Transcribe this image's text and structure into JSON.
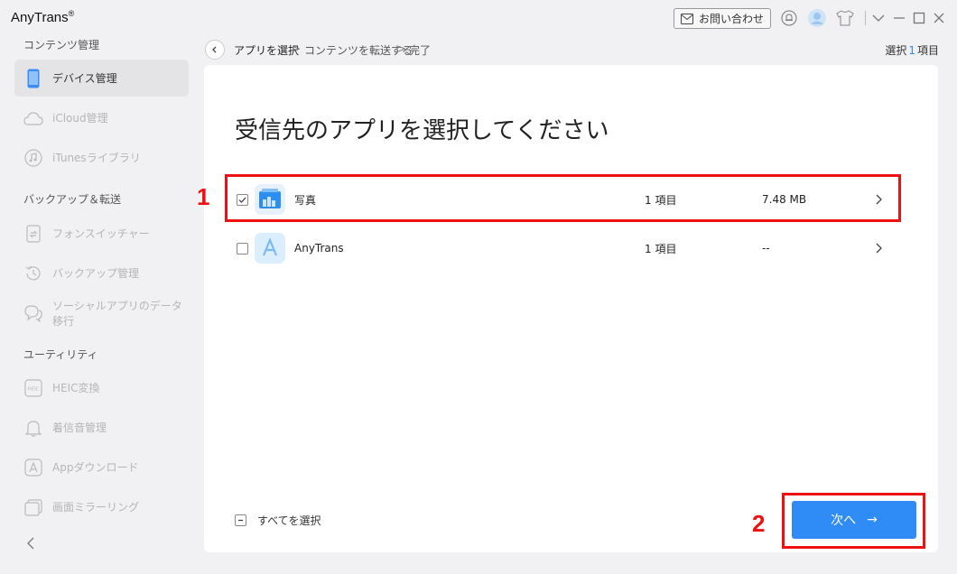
{
  "app": {
    "title": "AnyTrans",
    "registered": "®"
  },
  "titlebar": {
    "contact_label": "お問い合わせ"
  },
  "sidebar": {
    "sections": [
      {
        "title": "コンテンツ管理"
      },
      {
        "title": "バックアップ＆転送"
      },
      {
        "title": "ユーティリティ"
      }
    ],
    "items": [
      {
        "label": "デバイス管理",
        "icon": "phone-icon",
        "active": true
      },
      {
        "label": "iCloud管理",
        "icon": "cloud-icon"
      },
      {
        "label": "iTunesライブラリ",
        "icon": "music-icon"
      },
      {
        "label": "フォンスイッチャー",
        "icon": "phone-switch-icon"
      },
      {
        "label": "バックアップ管理",
        "icon": "history-icon"
      },
      {
        "label": "ソーシャルアプリのデータ移行",
        "icon": "chat-icon"
      },
      {
        "label": "HEIC変換",
        "icon": "heic-icon"
      },
      {
        "label": "着信音管理",
        "icon": "bell-icon"
      },
      {
        "label": "Appダウンロード",
        "icon": "app-store-icon"
      },
      {
        "label": "画面ミラーリング",
        "icon": "mirror-icon"
      }
    ]
  },
  "breadcrumb": {
    "steps": [
      "アプリを選択",
      "コンテンツを転送する",
      "完了"
    ],
    "separator": ">"
  },
  "selection": {
    "prefix": "選択",
    "count": "1",
    "suffix": "項目"
  },
  "main": {
    "heading": "受信先のアプリを選択してください",
    "apps": [
      {
        "name": "写真",
        "count": "1 項目",
        "size": "7.48 MB",
        "checked": true,
        "icon": "photos-app-icon"
      },
      {
        "name": "AnyTrans",
        "count": "1 項目",
        "size": "--",
        "checked": false,
        "icon": "anytrans-app-icon"
      }
    ],
    "select_all_label": "すべてを選択",
    "next_label": "次へ",
    "next_arrow": "→"
  },
  "annotations": {
    "first": "1",
    "second": "2"
  },
  "colors": {
    "accent": "#2f8bf5",
    "annotation": "#ee1111"
  }
}
